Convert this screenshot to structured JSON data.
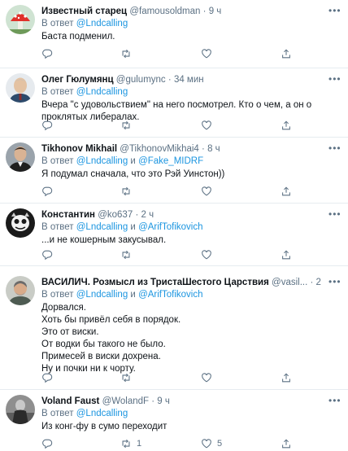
{
  "reply_prefix": "В ответ",
  "separator": "·",
  "more_glyph": "•••",
  "colors": {
    "link": "#1b95e0",
    "muted": "#5b7083",
    "text": "#0f1419",
    "divider": "#e6ecf0"
  },
  "icons": [
    "reply-icon",
    "retweet-icon",
    "like-icon",
    "share-icon",
    "more-icon"
  ],
  "tweets": [
    {
      "name": "Известный старец",
      "handle": "@famousoldman",
      "time": "9 ч",
      "replying_to": [
        "@Lndcalling"
      ],
      "text": [
        "Баста подменил."
      ],
      "retweets": "",
      "likes": ""
    },
    {
      "name": "Олег Гюлумянц",
      "handle": "@gulumync",
      "time": "34 мин",
      "replying_to": [
        "@Lndcalling"
      ],
      "text": [
        "Вчера \"с удовольствием\" на него посмотрел. Кто о чем, а он о",
        "проклятых либералах."
      ],
      "retweets": "",
      "likes": ""
    },
    {
      "name": "Tikhonov Mikhail",
      "handle": "@TikhonovMikhai4",
      "time": "8 ч",
      "replying_to": [
        "@Lndcalling",
        "@Fake_MIDRF"
      ],
      "text": [
        "Я подумал сначала, что это Рэй Уинстон))"
      ],
      "retweets": "",
      "likes": ""
    },
    {
      "name": "Константин",
      "handle": "@ko637",
      "time": "2 ч",
      "replying_to": [
        "@Lndcalling",
        "@ArifTofikovich"
      ],
      "text": [
        "...и не кошерным закусывал."
      ],
      "retweets": "",
      "likes": ""
    },
    {
      "name": "ВАСИЛИЧ. Розмысл из ТристаШестого Царствия",
      "handle": "@vasil...",
      "time": "2 ч",
      "replying_to": [
        "@Lndcalling",
        "@ArifTofikovich"
      ],
      "text": [
        "Дорвался.",
        "Хоть бы привёл себя в порядок.",
        "Это от виски.",
        "От водки бы такого не было.",
        "Примесей в виски дохрена.",
        "Ну и почки ни к чорту."
      ],
      "retweets": "",
      "likes": ""
    },
    {
      "name": "Voland Faust",
      "handle": "@WolandF",
      "time": "9 ч",
      "replying_to": [
        "@Lndcalling"
      ],
      "text": [
        "Из конг-фу в сумо переходит"
      ],
      "retweets": "1",
      "likes": "5"
    }
  ]
}
